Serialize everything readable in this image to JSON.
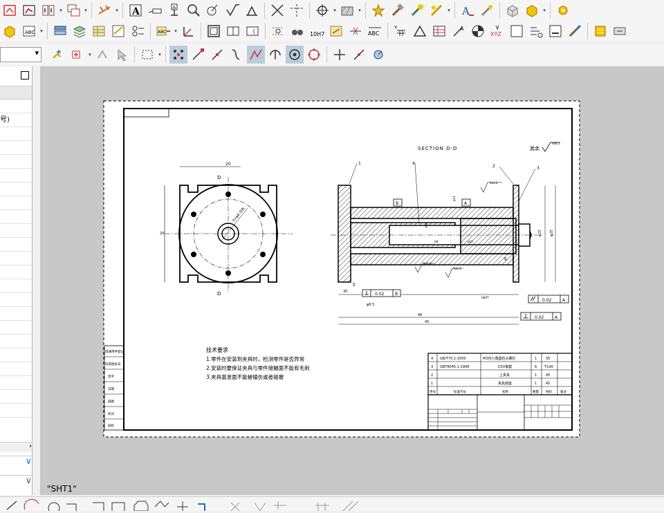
{
  "window": {
    "sheet_tab": "\"SHT1\""
  },
  "panel": {
    "partial_row_text": "号)",
    "scroll_arrow": "›",
    "expand_1": "∨",
    "expand_2": "∨"
  },
  "drawing": {
    "section_title": "SECTION  D-D",
    "finish_label": "其余",
    "finish_value": "Ra6.3",
    "left_view": {
      "dim_top": "20",
      "dim_left": "20",
      "hole_pattern": "4×φ8 均布",
      "label_top": "D",
      "label_bottom": "D"
    },
    "section_view": {
      "callouts": [
        "1",
        "4",
        "2",
        "3"
      ],
      "datum_b": "B",
      "datum_a": "A",
      "roughness": [
        "Ra3.2",
        "Ra1.6",
        "Ra6.3"
      ],
      "dims": [
        "30",
        "φ8.5",
        "46",
        "45",
        "φ25",
        "φ25",
        "φ4",
        "M8",
        "φ14",
        "φ6",
        "H8/f7",
        "φ10",
        "H6"
      ],
      "tol_perp_b": "0.02",
      "tol_perp_b_datum": "B",
      "tol_parallel": "0.02",
      "tol_parallel_datum": "A",
      "tol_perp_a": "0.02",
      "tol_perp_a_datum": "A"
    },
    "notes": {
      "title": "技术要求",
      "items": [
        "1.零件在安装到夹具时，检测零件是否异常",
        "2.安装时要保证夹具与零件接触面不能有毛刺",
        "3.夹具基准面不能被磕伤或者碰瘪"
      ]
    },
    "side_labels": [
      "借通用件登记",
      "旧底图总号",
      "签字",
      "日期",
      "描图",
      "校对",
      "描校"
    ],
    "bom": {
      "rows": [
        [
          "4",
          "GB/T70.1-2000",
          "M3内六角圆柱头螺钉",
          "1",
          "35",
          ""
        ],
        [
          "3",
          "GBT8045.1-1999",
          "D10销套",
          "6",
          "T10A",
          ""
        ],
        [
          "2",
          "",
          "上夹具",
          "1",
          "45",
          ""
        ],
        [
          "1",
          "",
          "夹具底座",
          "1",
          "45",
          ""
        ]
      ],
      "header": [
        "序号",
        "标准代号",
        "名称",
        "数量",
        "材料",
        "备注"
      ]
    }
  }
}
